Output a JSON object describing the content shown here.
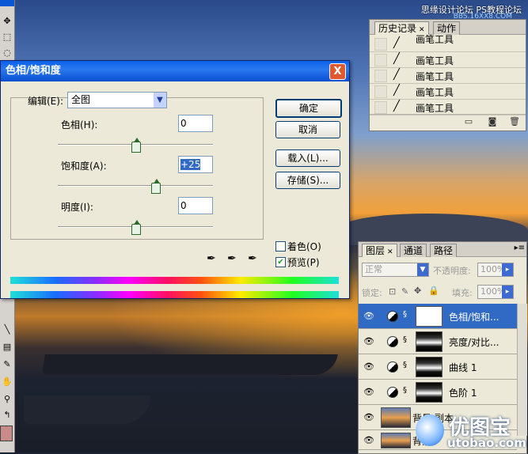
{
  "watermark": {
    "top": "思缘设计论坛 PS教程论坛",
    "top_sub": "BBS.16XX8.COM",
    "logo_cn": "优图宝",
    "logo_en": "utobao.com"
  },
  "history_panel": {
    "tabs": [
      "历史记录",
      "动作"
    ],
    "items": [
      "画笔工具",
      "画笔工具",
      "画笔工具",
      "画笔工具",
      "画笔工具"
    ]
  },
  "dialog": {
    "title": "色相/饱和度",
    "close": "X",
    "edit_label": "编辑(E):",
    "edit_value": "全图",
    "hue_label": "色相(H):",
    "hue_value": "0",
    "saturation_label": "饱和度(A):",
    "saturation_value": "+25",
    "lightness_label": "明度(I):",
    "lightness_value": "0",
    "ok": "确定",
    "cancel": "取消",
    "load": "载入(L)...",
    "save": "存储(S)...",
    "colorize": "着色(O)",
    "preview": "预览(P)",
    "hue_slider": 0,
    "saturation_slider": 25,
    "lightness_slider": 0
  },
  "layers_panel": {
    "tabs": [
      "图层",
      "通道",
      "路径"
    ],
    "blend_mode": "正常",
    "opacity_label": "不透明度:",
    "opacity_value": "100%",
    "lock_label": "锁定:",
    "fill_label": "填充:",
    "fill_value": "100%",
    "layers": [
      "色相/饱和...",
      "亮度/对比...",
      "曲线 1",
      "色阶 1",
      "背景 副本",
      "背景"
    ]
  }
}
